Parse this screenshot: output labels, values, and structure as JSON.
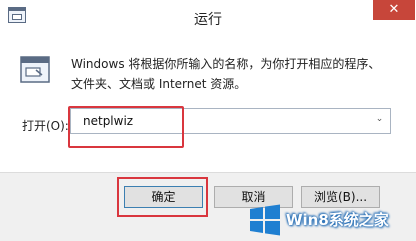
{
  "window": {
    "title": "运行",
    "close_glyph": "✕"
  },
  "description": {
    "line1": "Windows 将根据你所输入的名称，为你打开相应的程序、",
    "line2": "文件夹、文档或 Internet 资源。"
  },
  "open_field": {
    "label": "打开(O):",
    "value": "netplwiz",
    "dropdown_glyph": "⌄"
  },
  "buttons": {
    "ok": "确定",
    "cancel": "取消",
    "browse": "浏览(B)..."
  },
  "watermark": {
    "text": "Win8系统之家"
  },
  "colors": {
    "highlight": "#d9363e",
    "close_button": "#c7463a",
    "watermark_blue": "#1f6ab4"
  }
}
